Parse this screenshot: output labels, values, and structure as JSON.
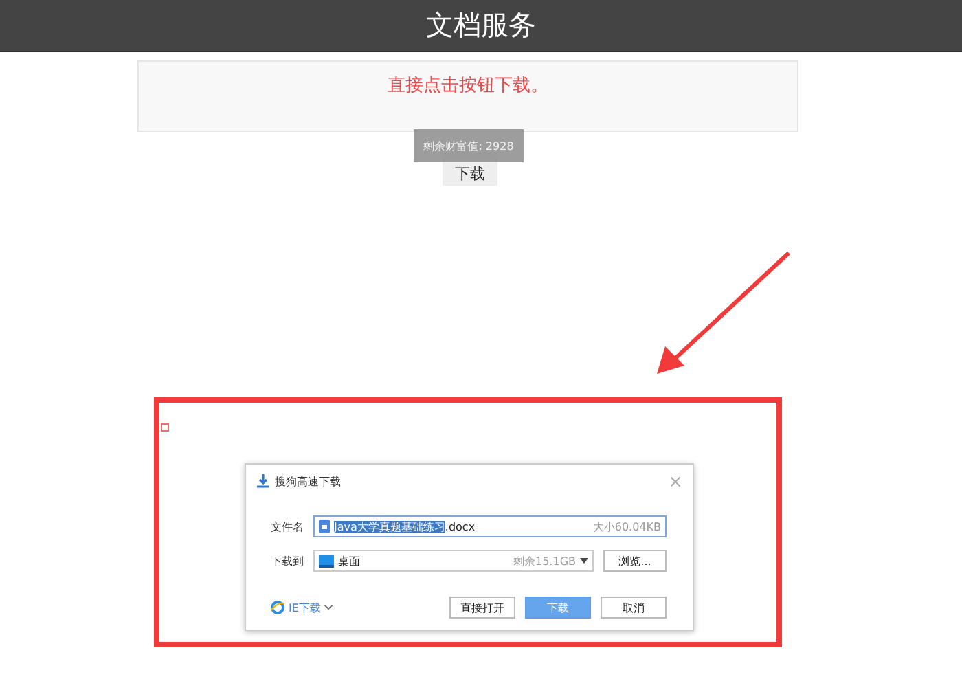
{
  "header": {
    "title": "文档服务"
  },
  "notice": {
    "text": "直接点击按钮下载。"
  },
  "download_button": {
    "label": "下载"
  },
  "tooltip": {
    "text": "剩余财富值: 2928"
  },
  "dialog": {
    "title": "搜狗高速下载",
    "file_label": "文件名",
    "file_selected": "Java大学真题基础练习",
    "file_rest": ".docx",
    "file_size": "大小60.04KB",
    "save_label": "下载到",
    "save_location": "桌面",
    "free_space": "剩余15.1GB",
    "browse": "浏览...",
    "ie_download": "IE下载",
    "buttons": [
      {
        "label": "直接打开",
        "primary": false
      },
      {
        "label": "下载",
        "primary": true
      },
      {
        "label": "取消",
        "primary": false
      }
    ]
  }
}
